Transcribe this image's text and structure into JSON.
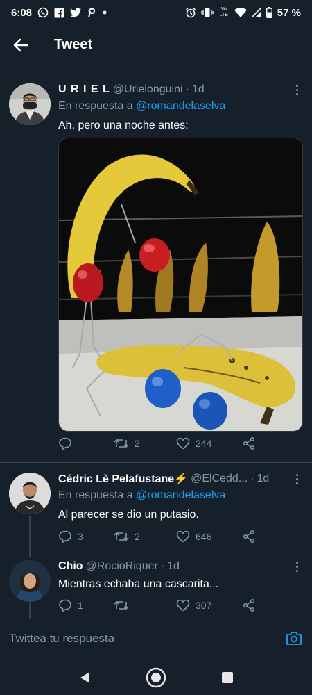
{
  "status_bar": {
    "time": "6:08",
    "battery": "57 %",
    "lte_label": "Vo LTE"
  },
  "header": {
    "title": "Tweet"
  },
  "main_tweet": {
    "name": "U R I E L",
    "handle": "@Urielonguini",
    "time": "1d",
    "reply_prefix": "En respuesta a",
    "reply_mention": "@romandelaselva",
    "text": "Ah, pero una noche antes:",
    "retweets": "2",
    "likes": "244"
  },
  "replies": [
    {
      "name": "Cédric Lè Pelafustane⚡",
      "handle": "@ElCedd...",
      "time": "1d",
      "reply_prefix": "En respuesta a",
      "reply_mention": "@romandelaselva",
      "text": "Al parecer se dio un putasio.",
      "replies": "3",
      "retweets": "2",
      "likes": "646"
    },
    {
      "name": "Chio",
      "handle": "@RocioRiquer",
      "time": "1d",
      "text": "Mientras echaba una cascarita...",
      "replies": "1",
      "retweets": "",
      "likes": "307"
    }
  ],
  "reply_bar": {
    "placeholder": "Twittea tu respuesta"
  },
  "colors": {
    "background": "#15202b",
    "accent": "#1da1f2",
    "muted": "#8899a6"
  }
}
